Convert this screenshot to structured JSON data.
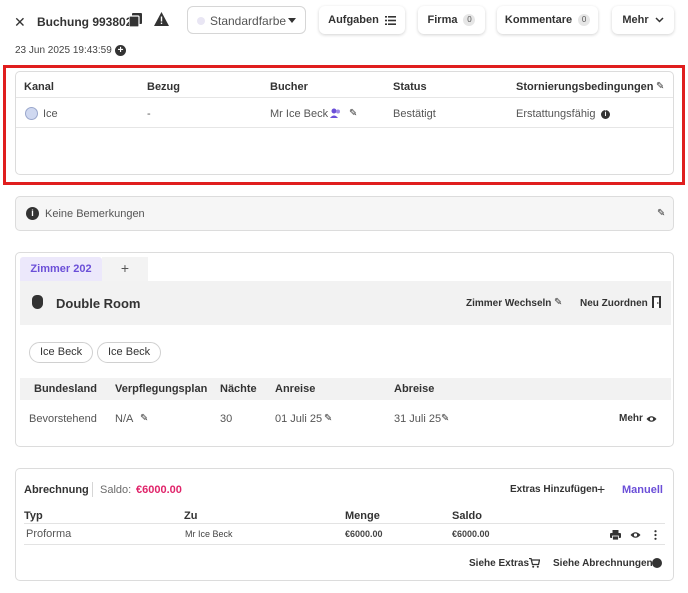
{
  "header": {
    "close_glyph": "✕",
    "booking_title": "Buchung 993802",
    "color_select": "Standardfarbe",
    "buttons": {
      "tasks": "Aufgaben",
      "company": "Firma",
      "company_count": "0",
      "comments": "Kommentare",
      "comments_count": "0",
      "more": "Mehr"
    },
    "timestamp": "23 Jun 2025 19:43:59"
  },
  "booking_table": {
    "headers": {
      "channel": "Kanal",
      "reference": "Bezug",
      "booker": "Bucher",
      "status": "Status",
      "cancellation": "Stornierungsbedingungen"
    },
    "row": {
      "channel": "Ice",
      "reference": "-",
      "booker": "Mr Ice Beck",
      "status": "Bestätigt",
      "cancellation": "Erstattungsfähig"
    }
  },
  "notes": {
    "text": "Keine Bemerkungen"
  },
  "room": {
    "tab_label": "Zimmer 202",
    "tab_add": "+",
    "room_type": "Double Room",
    "change_room": "Zimmer Wechseln",
    "reassign": "Neu Zuordnen",
    "guests": [
      "Ice Beck",
      "Ice Beck"
    ],
    "columns": {
      "state": "Bundesland",
      "meal_plan": "Verpflegungsplan",
      "nights": "Nächte",
      "arrival": "Anreise",
      "departure": "Abreise"
    },
    "values": {
      "state": "Bevorstehend",
      "meal_plan": "N/A",
      "nights": "30",
      "arrival": "01 Juli 25",
      "departure": "31 Juli 25",
      "more": "Mehr"
    }
  },
  "billing": {
    "title": "Abrechnung",
    "saldo_label": "Saldo:",
    "saldo_value": "€6000.00",
    "add_extras": "Extras Hinzufügen",
    "add_extras_glyph": "+",
    "manual": "Manuell",
    "columns": {
      "type": "Typ",
      "to": "Zu",
      "quantity": "Menge",
      "balance": "Saldo"
    },
    "row": {
      "type": "Proforma",
      "to": "Mr Ice Beck",
      "quantity": "€6000.00",
      "balance": "€6000.00"
    },
    "see_extras": "Siehe Extras",
    "see_invoices": "Siehe Abrechnungen"
  },
  "colors": {
    "accent": "#6b4fd8",
    "saldo": "#e0246a",
    "highlight_frame": "#e01e1e"
  }
}
